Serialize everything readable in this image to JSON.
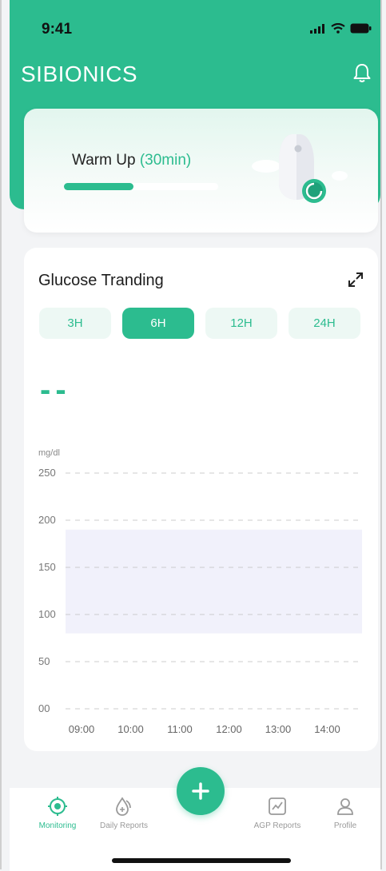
{
  "status_bar": {
    "time": "9:41"
  },
  "app": {
    "title": "SIBIONICS"
  },
  "warm_up": {
    "label": "Warm Up",
    "duration": "(30min)",
    "progress": 0.45
  },
  "glucose": {
    "title": "Glucose Tranding",
    "tabs": [
      {
        "label": "3H",
        "active": false
      },
      {
        "label": "6H",
        "active": true
      },
      {
        "label": "12H",
        "active": false
      },
      {
        "label": "24H",
        "active": false
      }
    ],
    "current_value": "--"
  },
  "chart_data": {
    "type": "line",
    "ylabel": "mg/dl",
    "ylim": [
      0,
      250
    ],
    "y_ticks": [
      "250",
      "200",
      "150",
      "100",
      "50",
      "00"
    ],
    "x_ticks": [
      "09:00",
      "10:00",
      "11:00",
      "12:00",
      "13:00",
      "14:00"
    ],
    "target_range": [
      80,
      190
    ],
    "grid": true,
    "series": []
  },
  "nav": {
    "items": [
      {
        "label": "Monitoring",
        "icon": "target-icon",
        "active": true
      },
      {
        "label": "Daily Reports",
        "icon": "drop-plus-icon",
        "active": false
      },
      {
        "label": "AGP Reports",
        "icon": "chart-line-icon",
        "active": false
      },
      {
        "label": "Profile",
        "icon": "user-icon",
        "active": false
      }
    ],
    "add_icon": "plus-icon"
  },
  "colors": {
    "accent": "#2cbc8f",
    "target_band": "#f1f1fb",
    "grid": "#cccccc"
  }
}
